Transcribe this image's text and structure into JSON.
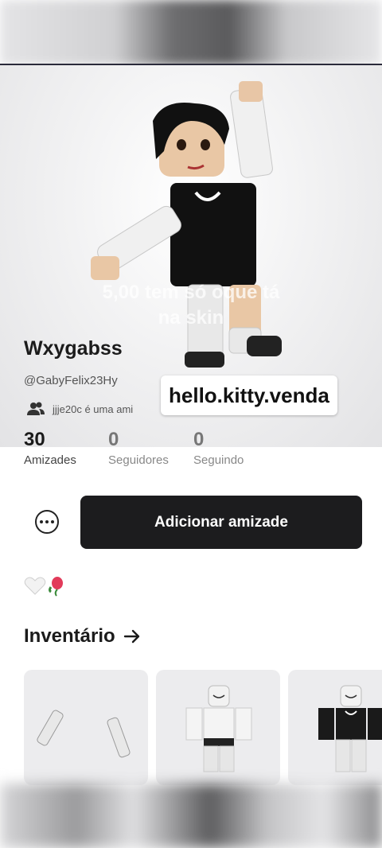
{
  "overlay": {
    "caption_line1": "5,00 tem só oque tá",
    "caption_line2": "na skin",
    "sticker": "hello.kitty.venda"
  },
  "profile": {
    "display_name": "Wxygabss",
    "username": "@GabyFelix23Hy",
    "mutual_friend_text": "jjje20c é uma ami",
    "status_emojis": "🤍🎈"
  },
  "stats": [
    {
      "value": "30",
      "label": "Amizades"
    },
    {
      "value": "0",
      "label": "Seguidores"
    },
    {
      "value": "0",
      "label": "Seguindo"
    }
  ],
  "actions": {
    "add_friend_label": "Adicionar amizade"
  },
  "inventory": {
    "title": "Inventário"
  },
  "icons": {
    "more": "more-options-icon",
    "friends": "friends-icon",
    "arrow": "arrow-right-icon"
  },
  "colors": {
    "primary_button": "#1c1c1e",
    "card_bg": "#ececee"
  }
}
